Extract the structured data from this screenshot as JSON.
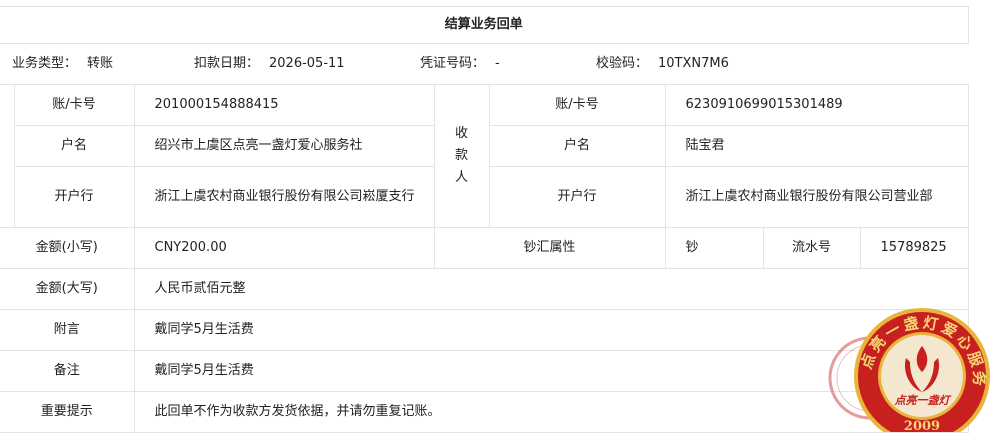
{
  "title": "结算业务回单",
  "meta": {
    "type_label": "业务类型：",
    "type_value": "转账",
    "date_label": "扣款日期：",
    "date_value": "2026-05-11",
    "voucher_label": "凭证号码：",
    "voucher_value": "-",
    "check_label": "校验码：",
    "check_value": "10TXN7M6"
  },
  "payer": {
    "account_label": "账/卡号",
    "account_value": "201000154888415",
    "name_label": "户名",
    "name_value": "绍兴市上虞区点亮一盏灯爱心服务社",
    "bank_label": "开户行",
    "bank_value": "浙江上虞农村商业银行股份有限公司崧厦支行"
  },
  "payee": {
    "side_label": [
      "收",
      "款",
      "人"
    ],
    "account_label": "账/卡号",
    "account_value": "6230910699015301489",
    "name_label": "户名",
    "name_value": "陆宝君",
    "bank_label": "开户行",
    "bank_value": "浙江上虞农村商业银行股份有限公司营业部"
  },
  "amount": {
    "small_label": "金额(小写)",
    "small_value": "CNY200.00",
    "fx_label": "钞汇属性",
    "fx_value": "钞",
    "serial_label": "流水号",
    "serial_value": "15789825",
    "big_label": "金额(大写)",
    "big_value": "人民币贰佰元整"
  },
  "notes": {
    "memo_label": "附言",
    "memo_value": "戴同学5月生活费",
    "remark_label": "备注",
    "remark_value": "戴同学5月生活费",
    "tip_label": "重要提示",
    "tip_value": "此回单不作为收款方发货依据，并请勿重复记账。"
  },
  "stamp": {
    "ring_text": "点亮一盏灯爱心服务社",
    "motto": "点亮一盏灯",
    "year": "2009",
    "colors": {
      "red": "#c8201e",
      "gold": "#e9b43a",
      "cream": "#f3e7cf"
    }
  }
}
